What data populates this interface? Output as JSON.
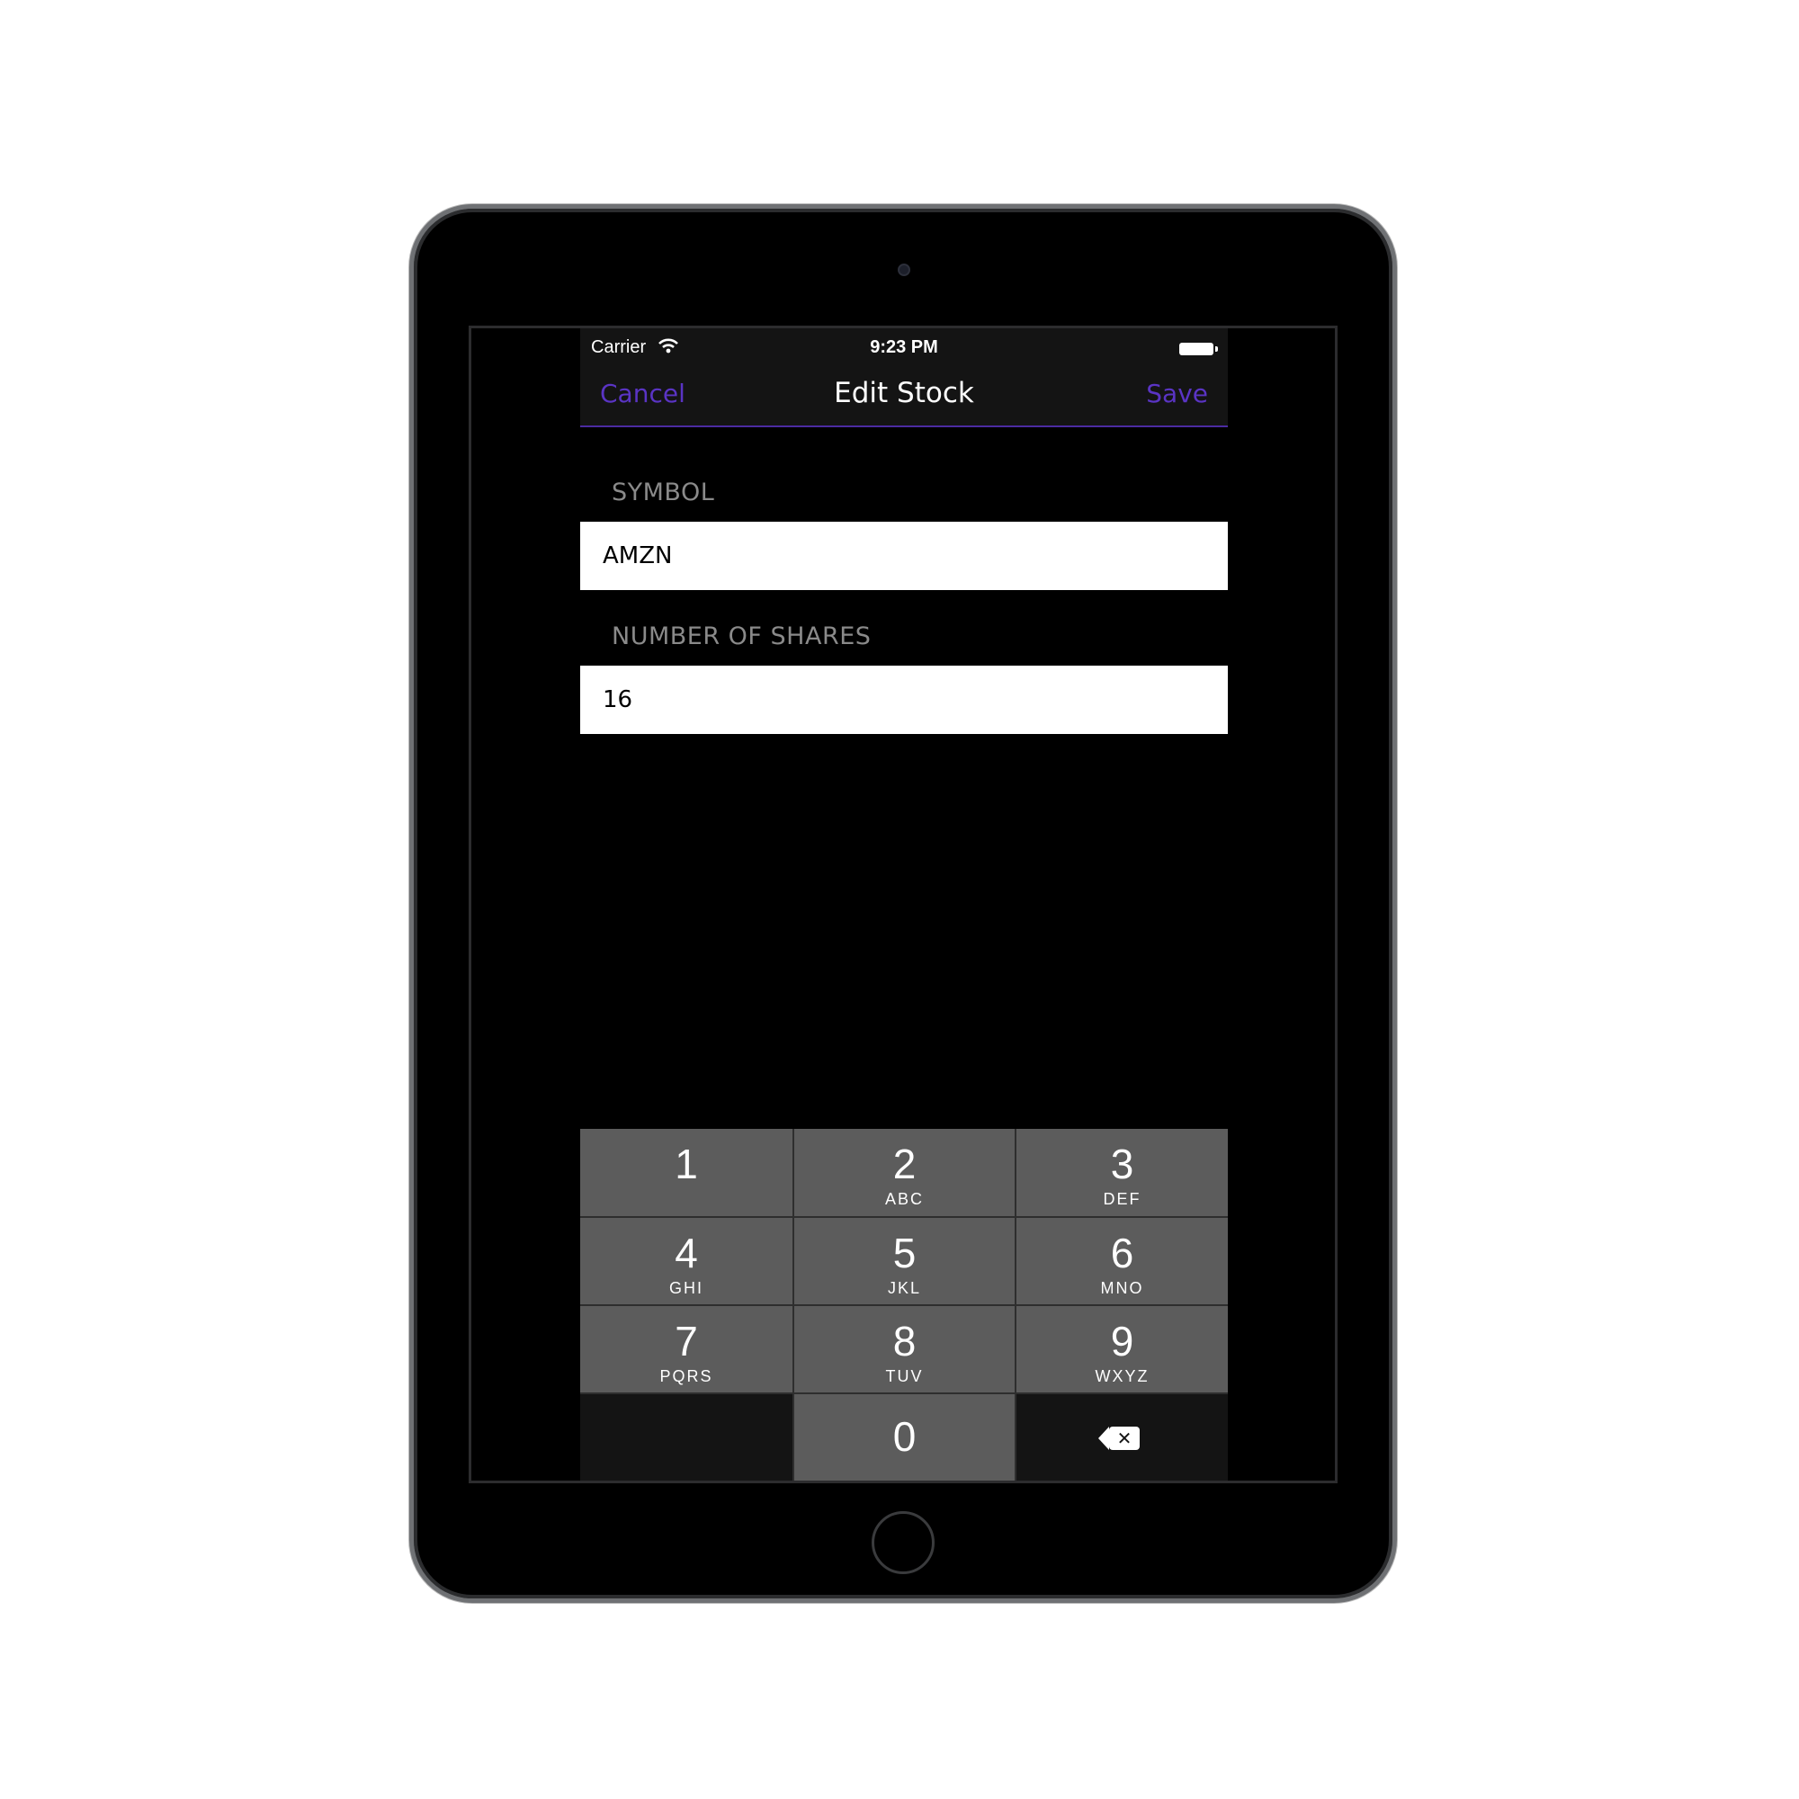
{
  "status_bar": {
    "carrier": "Carrier",
    "time": "9:23 PM",
    "wifi_icon": "wifi-icon",
    "battery_icon": "battery-icon"
  },
  "nav": {
    "cancel_label": "Cancel",
    "title": "Edit Stock",
    "save_label": "Save",
    "accent_color": "#5a34c4"
  },
  "form": {
    "symbol_label": "SYMBOL",
    "symbol_value": "AMZN",
    "shares_label": "NUMBER OF SHARES",
    "shares_value": "16"
  },
  "keypad": {
    "keys": [
      {
        "num": "1",
        "letters": ""
      },
      {
        "num": "2",
        "letters": "ABC"
      },
      {
        "num": "3",
        "letters": "DEF"
      },
      {
        "num": "4",
        "letters": "GHI"
      },
      {
        "num": "5",
        "letters": "JKL"
      },
      {
        "num": "6",
        "letters": "MNO"
      },
      {
        "num": "7",
        "letters": "PQRS"
      },
      {
        "num": "8",
        "letters": "TUV"
      },
      {
        "num": "9",
        "letters": "WXYZ"
      },
      {
        "num": "0",
        "letters": ""
      }
    ],
    "delete_icon": "backspace-icon"
  }
}
